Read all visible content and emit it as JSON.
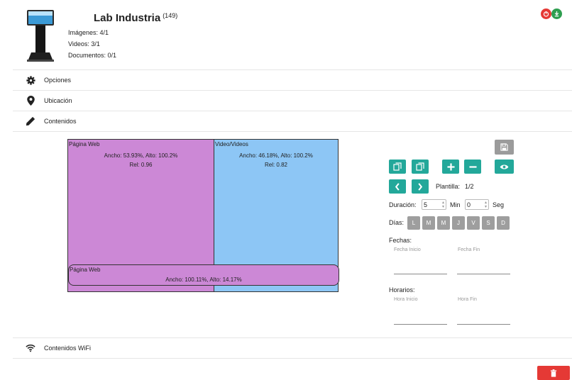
{
  "header": {
    "title": "Lab Industria",
    "count": "(149)",
    "stats": [
      "Imágenes: 4/1",
      "Videos: 3/1",
      "Documentos: 0/1"
    ]
  },
  "sections": {
    "opciones": "Opciones",
    "ubicacion": "Ubicación",
    "contenidos": "Contenidos",
    "wifi": "Contenidos WiFi"
  },
  "layout": {
    "regions": [
      {
        "title": "Página Web",
        "dims": "Ancho: 53.93%, Alto: 100.2%",
        "rel": "Rel: 0.96",
        "color": "#cc88d6"
      },
      {
        "title": "Video/Videos",
        "dims": "Ancho: 46.18%, Alto: 100.2%",
        "rel": "Rel: 0.82",
        "color": "#8dc6f5"
      },
      {
        "title": "Página Web",
        "dims": "Ancho: 100.11%, Alto: 14.17%",
        "color": "#cc88d6"
      }
    ]
  },
  "controls": {
    "plantilla_label": "Plantilla:",
    "plantilla_value": "1/2",
    "duracion_label": "Duración:",
    "duracion_min_value": "5",
    "min_label": "Min",
    "duracion_seg_value": "0",
    "seg_label": "Seg",
    "dias_label": "Días:",
    "days": [
      "L",
      "M",
      "M",
      "J",
      "V",
      "S",
      "D"
    ],
    "fechas_label": "Fechas:",
    "fecha_inicio": "Fecha Inicio",
    "fecha_fin": "Fecha Fin",
    "horarios_label": "Horarios:",
    "hora_inicio": "Hora Inicio",
    "hora_fin": "Hora Fin"
  },
  "colors": {
    "teal": "#23a89a",
    "red": "#e53935",
    "green": "#2e9e4f",
    "gray_button": "#9b9b9b"
  }
}
